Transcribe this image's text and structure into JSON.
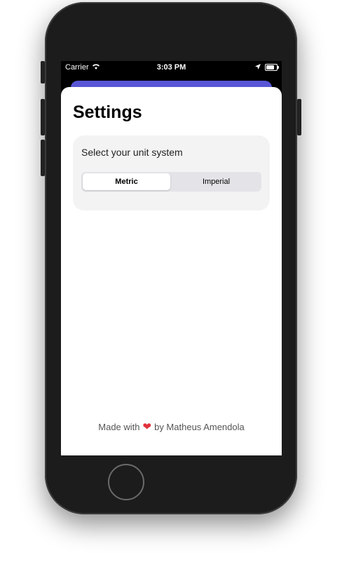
{
  "status_bar": {
    "carrier": "Carrier",
    "time": "3:03 PM"
  },
  "screen": {
    "title": "Settings",
    "unit_card": {
      "label": "Select your unit system",
      "options": [
        "Metric",
        "Imperial"
      ],
      "selected": "Metric"
    },
    "footer": {
      "prefix": "Made with",
      "heart": "❤",
      "suffix": "by Matheus Amendola"
    }
  },
  "colors": {
    "accent": "#5856d6",
    "heart": "#e0323c",
    "card_bg": "#f3f3f4"
  },
  "icons": [
    "wifi-icon",
    "location-arrow-icon",
    "battery-icon",
    "heart-icon"
  ]
}
